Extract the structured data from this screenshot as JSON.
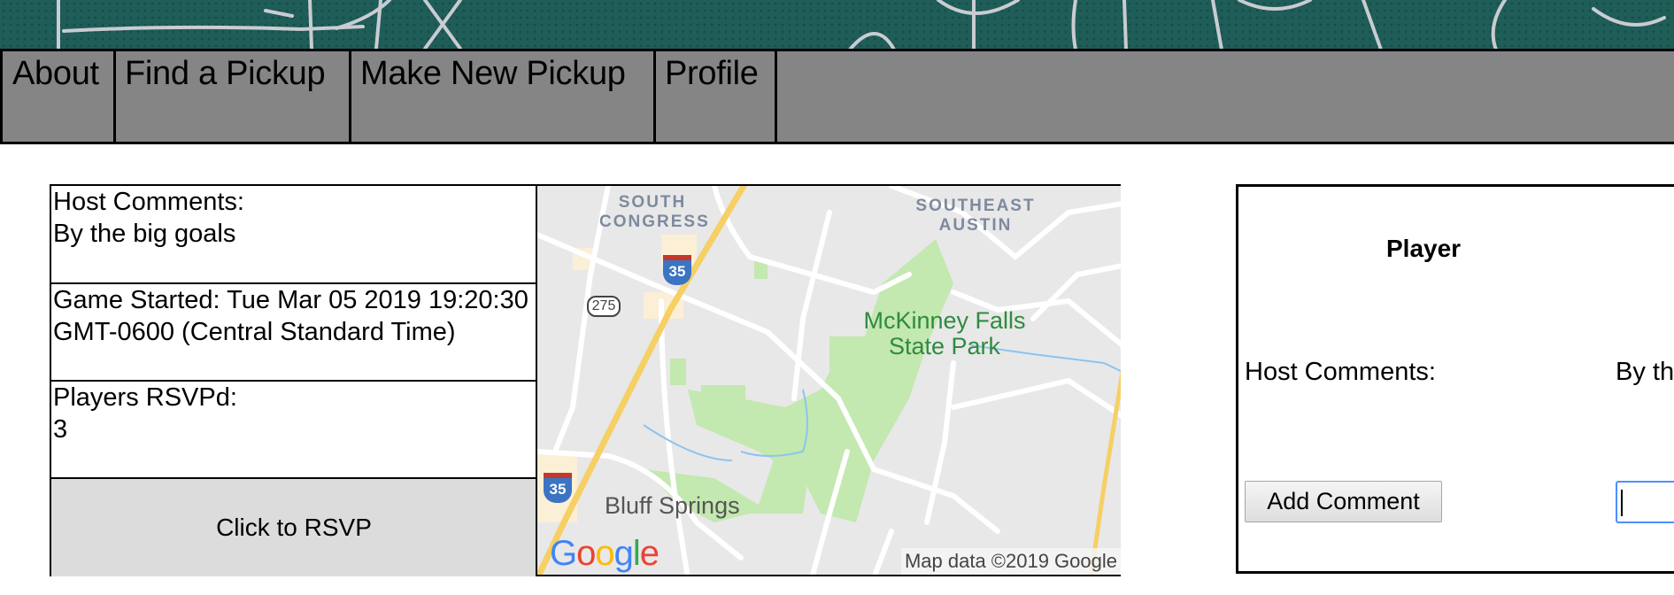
{
  "nav": {
    "items": [
      {
        "label": "About"
      },
      {
        "label": "Find a Pickup"
      },
      {
        "label": "Make New Pickup"
      },
      {
        "label": "Profile"
      }
    ]
  },
  "game": {
    "host_comments_label": "Host Comments:",
    "host_comments_value": "By the big goals",
    "started_text": "Game Started: Tue Mar 05 2019 19:20:30 GMT-0600 (Central Standard Time)",
    "players_label": "Players RSVPd:",
    "players_count": "3",
    "rsvp_button": "Click to RSVP"
  },
  "map": {
    "labels": {
      "area1": "SOUTH CONGRESS",
      "area2": "SOUTHEAST AUSTIN",
      "park": "McKinney Falls State Park",
      "town": "Bluff Springs"
    },
    "shields": {
      "interstate": "35",
      "state": "275"
    },
    "logo": [
      "G",
      "o",
      "o",
      "g",
      "l",
      "e"
    ],
    "attribution": "Map data ©2019 Google"
  },
  "side_panel": {
    "header": "Player",
    "host_comments_label": "Host Comments:",
    "host_comments_value": "By the big goals",
    "add_comment_button": "Add Comment",
    "comment_input_value": ""
  },
  "colors": {
    "nav_bg": "#858585",
    "banner_bg": "#1f5d58",
    "rsvp_bg": "#dcdcdc",
    "input_focus": "#4d90fe"
  }
}
